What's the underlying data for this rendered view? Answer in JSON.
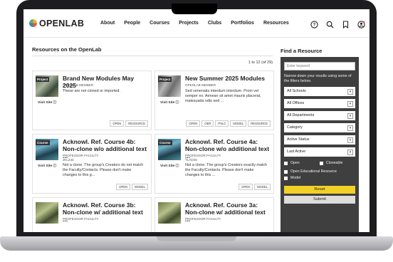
{
  "nav": {
    "logo": "OPENLAB",
    "links": [
      "About",
      "People",
      "Courses",
      "Projects",
      "Clubs",
      "Portfolios",
      "Resources"
    ],
    "icons": [
      "help-icon",
      "search-icon",
      "bookmark-icon",
      "user-icon"
    ]
  },
  "main": {
    "section_title": "Resources on the OpenLab",
    "count": "1 to 12 (of 29)",
    "visit_label": "Visit Site ⓘ",
    "cards": [
      {
        "type": "Project",
        "title": "Brand New Modules May 2025",
        "meta": "OPENLAB MEMBER",
        "desc": "These are not cloned or imported.",
        "tags": [
          "OPEN",
          "RESOURCE"
        ]
      },
      {
        "type": "Project",
        "title": "New Summer 2025 Modules",
        "meta": "OPENLAB MEMBER",
        "desc": "Sed venenatis interdum interdum. Proin vel semper ex. Aenean sit amet mauris placerat, malesuada odio sed ...",
        "tags": [
          "OPEN",
          "OER",
          "PSLC",
          "MODEL",
          "RESOURCE"
        ]
      },
      {
        "type": "Course",
        "title": "Acknowl. Ref. Course 4b: Non-clone w/o additional text ...",
        "meta": "PROFESSOR FACULTY",
        "meta2": "JKL234",
        "desc": "Not a clone. The group's Creators do not match the Faculty/Contacts. Please don't make changes to this g...",
        "tags": [
          "OPEN",
          "MODEL"
        ]
      },
      {
        "type": "Course",
        "title": "Acknowl. Ref. Course 4a: Non-clone w/o additional text ...",
        "meta": "PROFESSOR FACULTY",
        "meta2": "TLAD45",
        "desc": "Not a clone. The group's Creators exactly match the Faculty/Contacts. Please don't make changes to this ...",
        "tags": [
          "OPEN",
          "MODEL"
        ]
      },
      {
        "type": "Course",
        "title": "Acknowl. Ref. Course 3b: Non-clone w/ additional text ...",
        "meta": "PROFESSOR FACULTY"
      },
      {
        "type": "Course",
        "title": "Acknowl. Ref. Course 3a: Non-clone w/ additional text ...",
        "meta": "PROFESSOR FACULTY"
      }
    ]
  },
  "sidebar": {
    "title": "Find a Resource",
    "keyword_placeholder": "Enter keyword",
    "hint": "Narrow down your results using some of the filters below.",
    "selects": [
      "All Schools",
      "All Offices",
      "All Departments",
      "Category",
      "Active Status",
      "Last Active"
    ],
    "checks": [
      "Open",
      "Cloneable",
      "Open Educational Resource",
      "Model"
    ],
    "reset": "Reset",
    "submit": "Submit"
  },
  "colors": {
    "reset": "#f2d027",
    "panel": "#3f3f3f"
  }
}
